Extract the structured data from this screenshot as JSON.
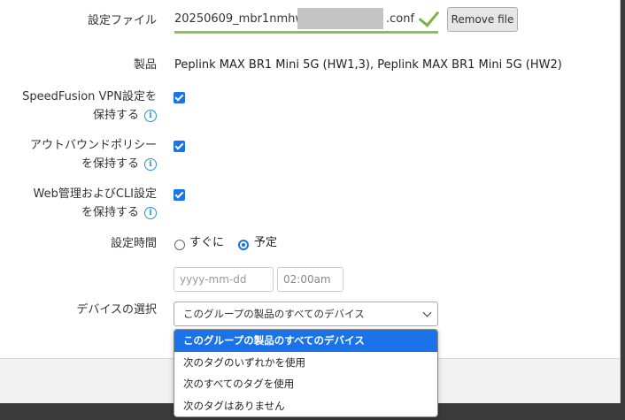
{
  "config_file": {
    "label": "設定ファイル",
    "file_name_visible": "20250609_mbr1nmhw1_",
    "file_ext": ".conf",
    "remove_button": "Remove file"
  },
  "product": {
    "label": "製品",
    "value": "Peplink MAX BR1 Mini 5G (HW1,3), Peplink MAX BR1 Mini 5G (HW2)"
  },
  "options": [
    {
      "line1": "SpeedFusion VPN設定を",
      "line2": "保持する",
      "checked": true
    },
    {
      "line1": "アウトバウンドポリシー",
      "line2": "を保持する",
      "checked": true
    },
    {
      "line1": "Web管理およびCLI設定",
      "line2": "を保持する",
      "checked": true
    }
  ],
  "schedule": {
    "label": "設定時間",
    "radio_now": "すぐに",
    "radio_scheduled": "予定",
    "selected": "予定",
    "date_placeholder": "yyyy-mm-dd",
    "time_value": "02:00am"
  },
  "device_select": {
    "label": "デバイスの選択",
    "selected": "このグループの製品のすべてのデバイス",
    "options": [
      "このグループの製品のすべてのデバイス",
      "次のタグのいずれかを使用",
      "次のすべてのタグを使用",
      "次のタグはありません"
    ]
  },
  "colors": {
    "accent": "#1a73e8",
    "success": "#8bc34a",
    "info": "#2b8fd6"
  }
}
